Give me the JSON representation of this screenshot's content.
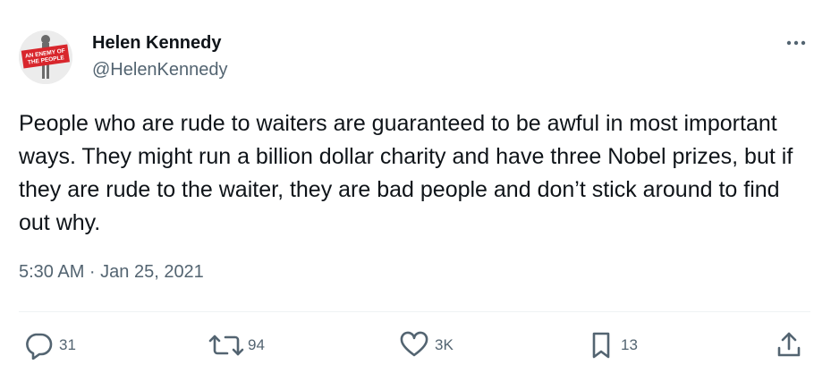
{
  "author": {
    "name": "Helen Kennedy",
    "handle": "@HelenKennedy",
    "avatar_badge_line1": "AN ENEMY OF",
    "avatar_badge_line2": "THE PEOPLE"
  },
  "tweet": {
    "text": "People who are rude to waiters are guaranteed to be awful in most important ways. They might run a billion dollar charity and have three Nobel prizes, but if they are rude to the waiter, they are bad people and don’t stick around to find out why.",
    "timestamp": "5:30 AM · Jan 25, 2021"
  },
  "actions": {
    "replies": "31",
    "retweets": "94",
    "likes": "3K",
    "bookmarks": "13"
  },
  "icons": {
    "more": "more-horizontal-icon",
    "reply": "reply-icon",
    "retweet": "retweet-icon",
    "like": "heart-icon",
    "bookmark": "bookmark-icon",
    "share": "share-icon"
  },
  "colors": {
    "text_primary": "#0f1419",
    "text_secondary": "#536471",
    "divider": "#eff3f4",
    "avatar_badge": "#d8262c"
  }
}
